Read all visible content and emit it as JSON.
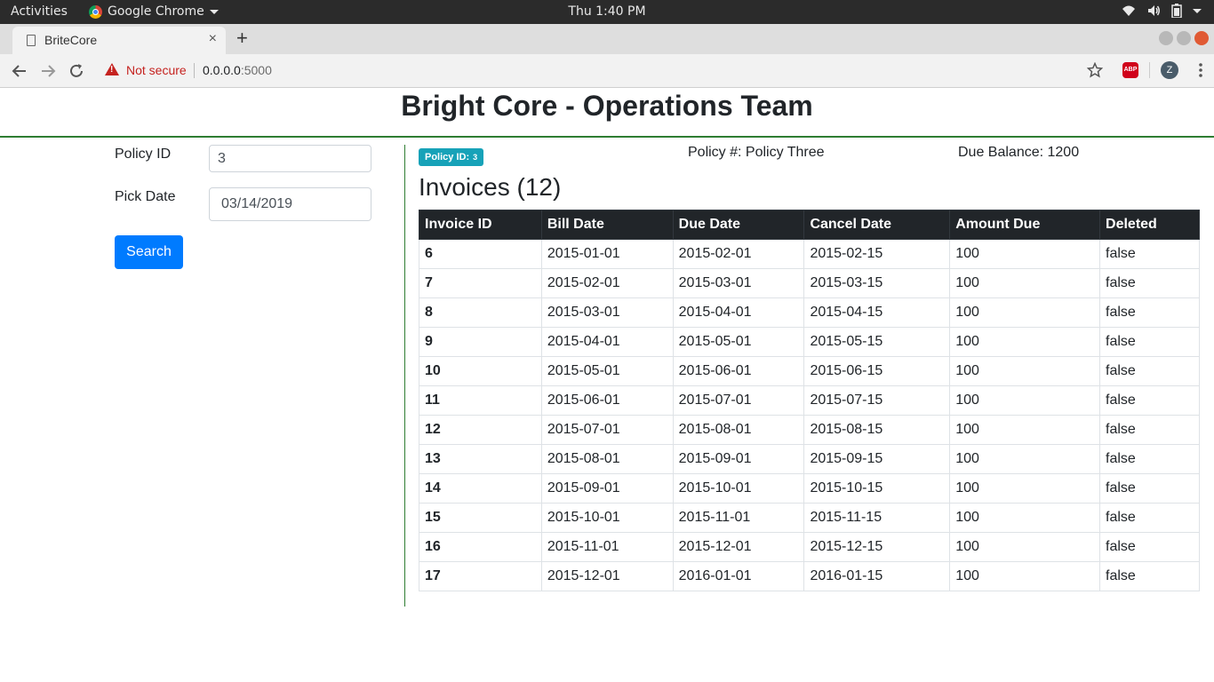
{
  "os_bar": {
    "activities": "Activities",
    "app_name": "Google Chrome",
    "clock": "Thu  1:40 PM"
  },
  "browser": {
    "tab_title": "BriteCore",
    "tab_close": "×",
    "new_tab": "+",
    "security_label": "Not secure",
    "url_host": "0.0.0.0",
    "url_port": ":5000",
    "adblock_label": "ABP",
    "profile_initial": "Z"
  },
  "page": {
    "title": "Bright Core - Operations Team"
  },
  "form": {
    "policy_id_label": "Policy ID",
    "policy_id_value": "3",
    "pick_date_label": "Pick Date",
    "pick_date_value": "03/14/2019",
    "search_button": "Search"
  },
  "summary": {
    "badge_label": "Policy ID:",
    "badge_value": "3",
    "policy_number": "Policy #: Policy Three",
    "due_balance": "Due Balance: 1200",
    "invoices_heading": "Invoices (12)"
  },
  "invoices_table": {
    "columns": [
      "Invoice ID",
      "Bill Date",
      "Due Date",
      "Cancel Date",
      "Amount Due",
      "Deleted"
    ],
    "rows": [
      [
        "6",
        "2015-01-01",
        "2015-02-01",
        "2015-02-15",
        "100",
        "false"
      ],
      [
        "7",
        "2015-02-01",
        "2015-03-01",
        "2015-03-15",
        "100",
        "false"
      ],
      [
        "8",
        "2015-03-01",
        "2015-04-01",
        "2015-04-15",
        "100",
        "false"
      ],
      [
        "9",
        "2015-04-01",
        "2015-05-01",
        "2015-05-15",
        "100",
        "false"
      ],
      [
        "10",
        "2015-05-01",
        "2015-06-01",
        "2015-06-15",
        "100",
        "false"
      ],
      [
        "11",
        "2015-06-01",
        "2015-07-01",
        "2015-07-15",
        "100",
        "false"
      ],
      [
        "12",
        "2015-07-01",
        "2015-08-01",
        "2015-08-15",
        "100",
        "false"
      ],
      [
        "13",
        "2015-08-01",
        "2015-09-01",
        "2015-09-15",
        "100",
        "false"
      ],
      [
        "14",
        "2015-09-01",
        "2015-10-01",
        "2015-10-15",
        "100",
        "false"
      ],
      [
        "15",
        "2015-10-01",
        "2015-11-01",
        "2015-11-15",
        "100",
        "false"
      ],
      [
        "16",
        "2015-11-01",
        "2015-12-01",
        "2015-12-15",
        "100",
        "false"
      ],
      [
        "17",
        "2015-12-01",
        "2016-01-01",
        "2016-01-15",
        "100",
        "false"
      ]
    ]
  },
  "colors": {
    "accent_green": "#2e7d32",
    "primary_button": "#007bff",
    "badge_info": "#17a2b8",
    "table_header": "#212529",
    "not_secure_red": "#c5221f"
  },
  "icons": {
    "back": "back-arrow-icon",
    "forward": "forward-arrow-icon",
    "reload": "reload-icon",
    "warning": "warning-icon",
    "bookmark": "star-icon",
    "menu": "kebab-menu-icon",
    "wifi": "wifi-icon",
    "volume": "volume-icon",
    "battery": "battery-icon"
  }
}
